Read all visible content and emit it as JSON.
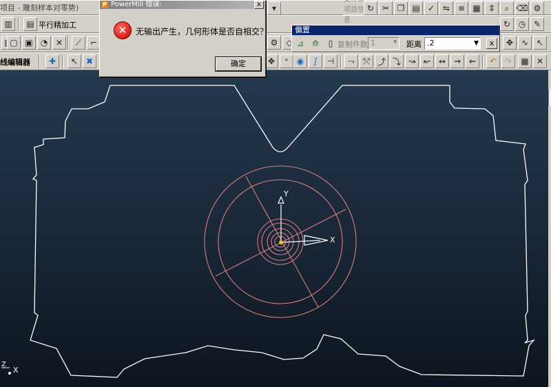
{
  "window": {
    "title_fragment": "项目 - 雕刻样本对零势)"
  },
  "toolbar": {
    "strategy_label": "平行精加工",
    "curve_editor_label": "线编辑器",
    "faded_fragment": "文件系 项目信息"
  },
  "offset_toolbar": {
    "title": "偏置",
    "copies_label": "复制件数",
    "copies_value": "1",
    "distance_label": "距离",
    "distance_value": ".2",
    "close_label": "x"
  },
  "error_dialog": {
    "title": "PowerMill 错误:",
    "app_icon_letter": "P",
    "message": "无输出产生，几何形体是否自相交？",
    "ok_label": "确定",
    "close_label": "x"
  },
  "viewport": {
    "axis_x_label": "X",
    "axis_y_label": "Y",
    "corner_axis_label": "X",
    "corner_axis_z": "Z",
    "colors": {
      "outline": "#ffffff",
      "circles": "#d97d7d",
      "axis": "#ffffff",
      "origin": "#f0c020"
    }
  }
}
